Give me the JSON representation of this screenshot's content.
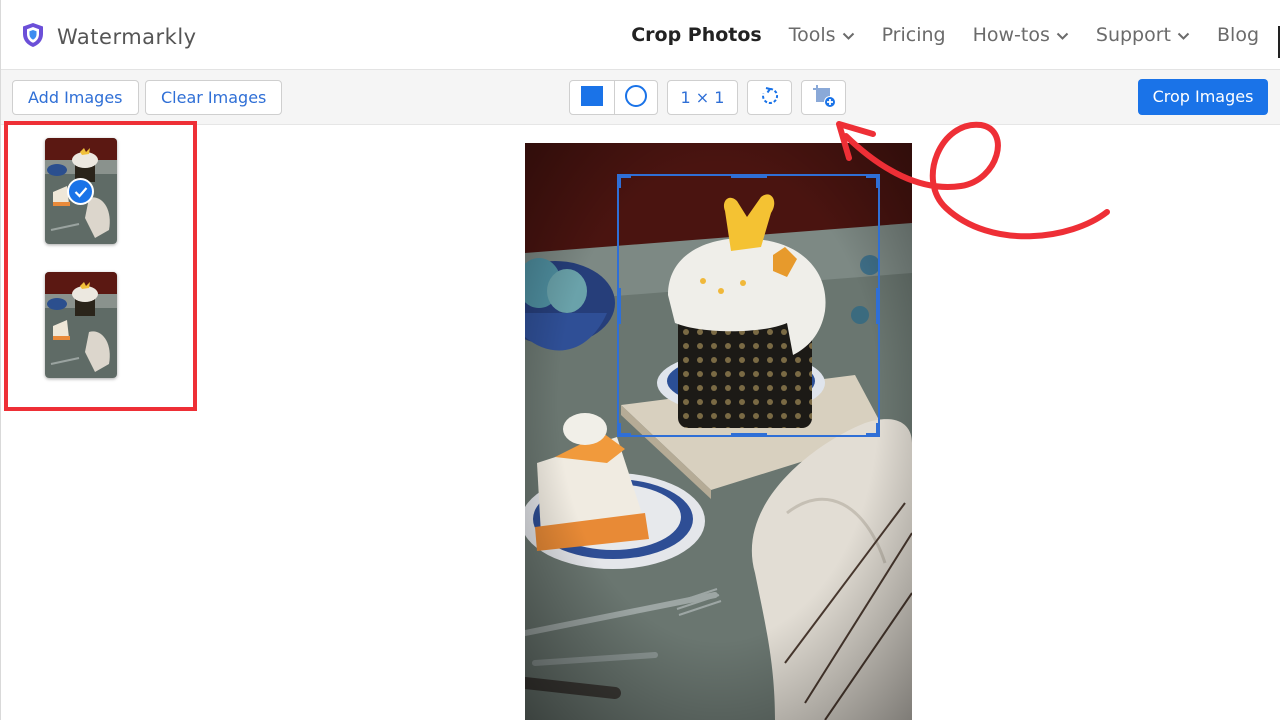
{
  "app": {
    "name": "Watermarkly"
  },
  "nav": {
    "items": [
      {
        "label": "Crop Photos",
        "active": true,
        "dropdown": false
      },
      {
        "label": "Tools",
        "active": false,
        "dropdown": true
      },
      {
        "label": "Pricing",
        "active": false,
        "dropdown": false
      },
      {
        "label": "How-tos",
        "active": false,
        "dropdown": true
      },
      {
        "label": "Support",
        "active": false,
        "dropdown": true
      },
      {
        "label": "Blog",
        "active": false,
        "dropdown": false
      }
    ]
  },
  "toolbar": {
    "add_images_label": "Add Images",
    "clear_images_label": "Clear Images",
    "ratio_label": "1 × 1",
    "crop_images_label": "Crop Images",
    "icons": [
      "rectangle-shape-icon",
      "circle-shape-icon",
      "rotate-icon",
      "add-crop-preset-icon"
    ]
  },
  "sidebar": {
    "thumbnails": [
      {
        "name": "cake-photo-1",
        "selected": true
      },
      {
        "name": "cake-photo-2",
        "selected": false
      }
    ]
  },
  "colors": {
    "accent": "#1a73e8",
    "link_blue": "#2f6fd6",
    "annotation_red": "#ee2f36",
    "logo_purple": "#6b4fd8"
  }
}
